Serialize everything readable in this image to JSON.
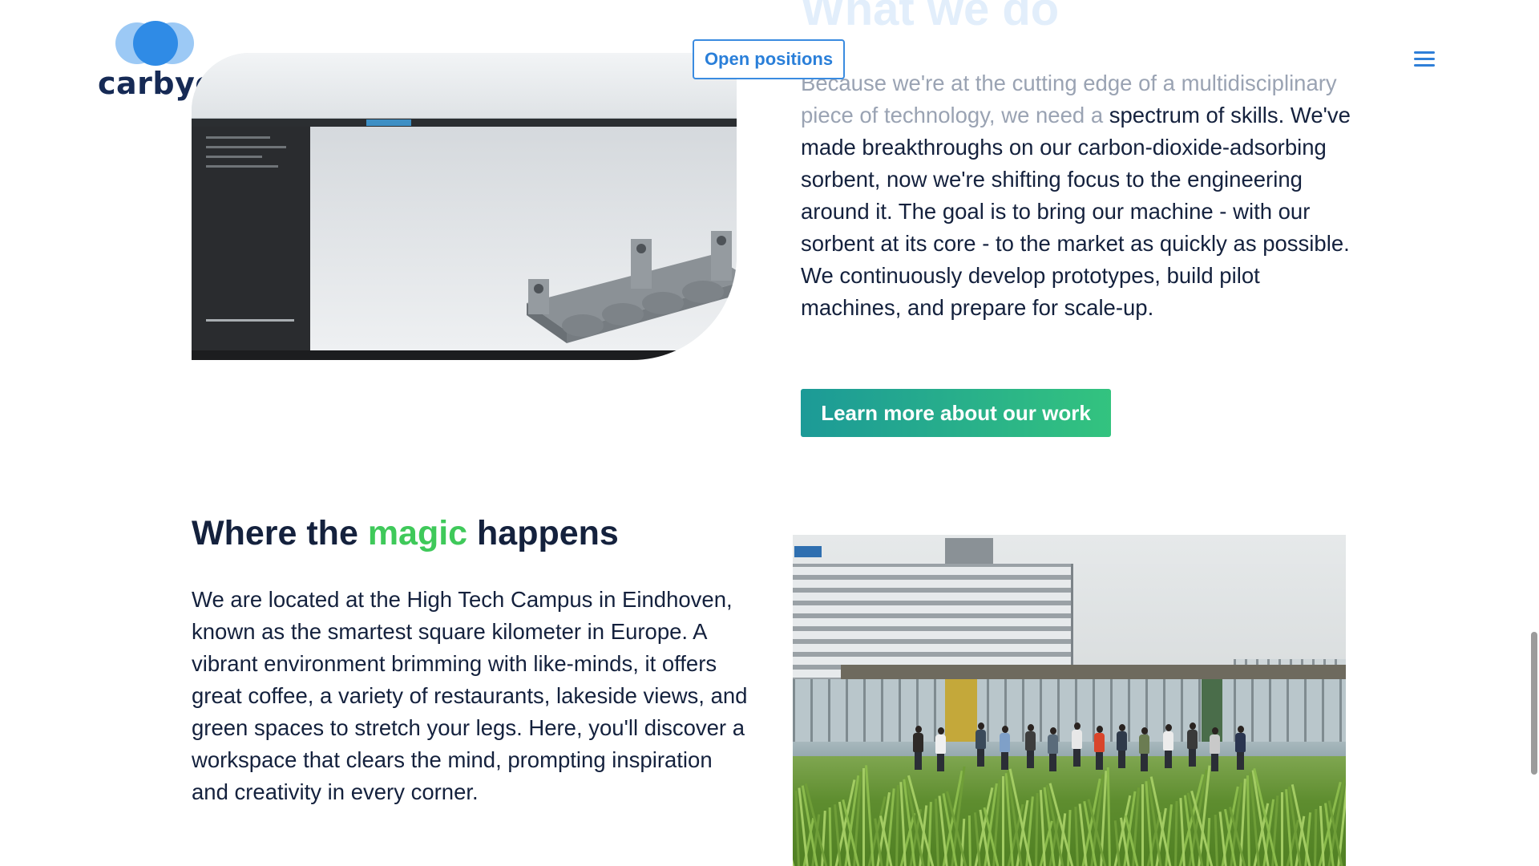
{
  "brand": {
    "name": "carbyon"
  },
  "header": {
    "open_positions_label": "Open positions",
    "menu_icon": "hamburger-menu-icon"
  },
  "what_we_do": {
    "title": "What we do",
    "paragraph_faded": "Because we're at the cutting edge of a multidisciplinary piece of technology, we need a",
    "paragraph": "spectrum of skills. We've made breakthroughs on our carbon-dioxide-adsorbing sorbent, now we're shifting focus to the engineering around it. The goal is to bring our machine - with our sorbent at its core - to the market as quickly as possible. We continuously develop prototypes, build pilot machines, and prepare for scale-up.",
    "cta_label": "Learn more about our work"
  },
  "magic": {
    "title_before": "Where the ",
    "title_accent": "magic",
    "title_after": " happens",
    "paragraph": "We are located at the High Tech Campus in Eindhoven, known as the smartest square kilometer in Europe. A vibrant environment brimming with like-minds, it offers great coffee, a variety of restaurants, lakeside views, and green spaces to stretch your legs. Here, you'll discover a workspace that clears the mind, prompting inspiration and creativity in every corner."
  },
  "colors": {
    "navy": "#14213d",
    "accent_blue": "#2a7fd9",
    "accent_green": "#3fc95a",
    "cta_gradient_start": "#1c9a97",
    "cta_gradient_end": "#33c37f"
  }
}
